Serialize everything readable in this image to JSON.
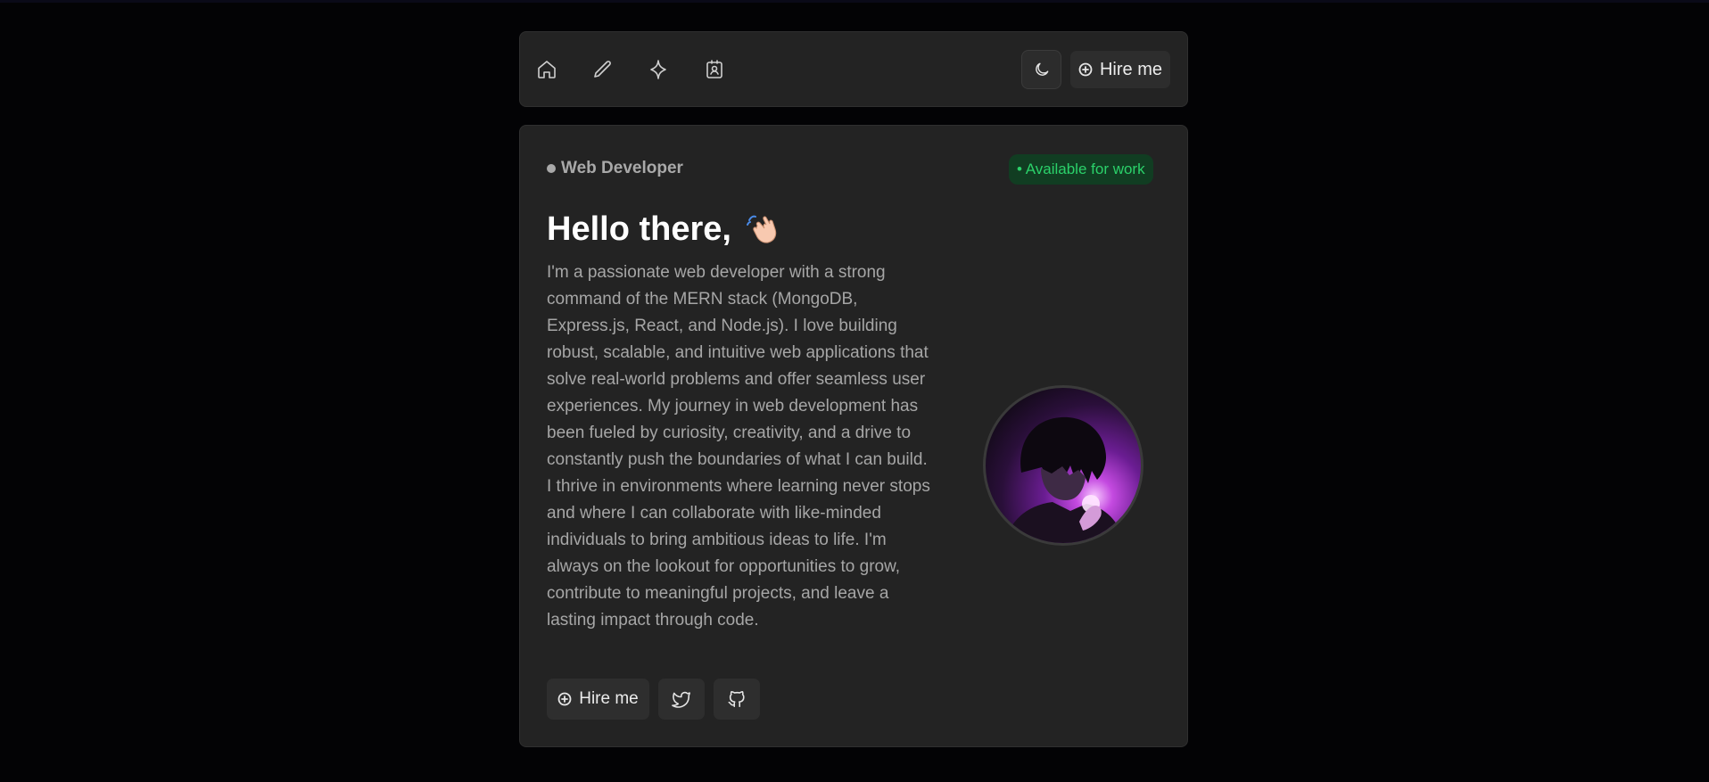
{
  "navbar": {
    "icons": [
      "home-icon",
      "pencil-icon",
      "sparkle-icon",
      "contact-card-icon"
    ],
    "theme_icon": "moon-icon",
    "hire_label": "Hire me"
  },
  "hero": {
    "role": "Web Developer",
    "badge": "• Available for work",
    "heading": "Hello there,",
    "emoji": "waving-hand",
    "bio": "I'm a passionate web developer with a strong command of the MERN stack (MongoDB, Express.js, React, and Node.js). I love building robust, scalable, and intuitive web applications that solve real-world problems and offer seamless user experiences. My journey in web development has been fueled by curiosity, creativity, and a drive to constantly push the boundaries of what I can build. I thrive in environments where learning never stops and where I can collaborate with like-minded individuals to bring ambitious ideas to life. I'm always on the lookout for opportunities to grow, contribute to meaningful projects, and leave a lasting impact through code.",
    "buttons": {
      "hire_label": "Hire me",
      "social": [
        "twitter-icon",
        "github-icon"
      ]
    }
  },
  "colors": {
    "background": "#030305",
    "card": "#232323",
    "badge_bg": "#113d22",
    "badge_text": "#2bd16a"
  }
}
